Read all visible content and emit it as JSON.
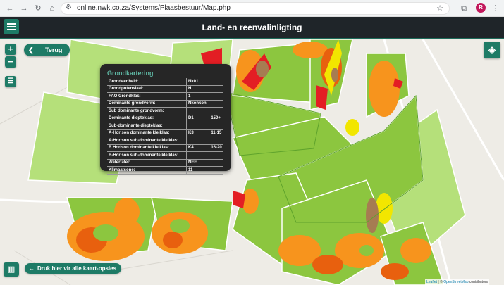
{
  "browser": {
    "url": "online.nwk.co.za/Systems/Plaasbestuur/Map.php",
    "avatar_letter": "R"
  },
  "app": {
    "title": "Land- en reenvalinligting"
  },
  "controls": {
    "zoom_in": "+",
    "zoom_out": "−",
    "back_label": "Terug",
    "options_label": "Druk hier vir alle kaart-opsies"
  },
  "popup": {
    "title": "Grondkartering",
    "rows": [
      {
        "label": "Grondeenheid:",
        "value": "Nk01",
        "extra": ""
      },
      {
        "label": "Grondpotensiaal:",
        "value": "H",
        "extra": ""
      },
      {
        "label": "FAO Grondklas:",
        "value": "1",
        "extra": ""
      },
      {
        "label": "Dominante grondvorm:",
        "value": "Nkonkoni",
        "extra": ""
      },
      {
        "label": "Sub dominante grondvorm:",
        "value": "",
        "extra": ""
      },
      {
        "label": "Dominante diepteklas:",
        "value": "D1",
        "extra": "150+"
      },
      {
        "label": "Sub-dominante diepteklas:",
        "value": "",
        "extra": ""
      },
      {
        "label": "A-Horison dominante kleiklas:",
        "value": "K3",
        "extra": "11-15"
      },
      {
        "label": "A-Horison sub-dominante kleiklas:",
        "value": "",
        "extra": ""
      },
      {
        "label": "B Horison dominante kleiklas:",
        "value": "K4",
        "extra": "16-20"
      },
      {
        "label": "B-Horison sub-dominante kleiklas:",
        "value": "",
        "extra": ""
      },
      {
        "label": "Watertafel:",
        "value": "NEE",
        "extra": ""
      },
      {
        "label": "Klimaatsone:",
        "value": "11",
        "extra": ""
      }
    ]
  },
  "attribution": {
    "leaflet": "Leaflet",
    "separator": "|",
    "copyright": "©",
    "osm": "OpenStreetMap",
    "suffix": "contributors"
  },
  "icons": {
    "back": "arrow-left-icon",
    "layers": "layers-icon",
    "map": "map-icon",
    "filter": "filter-icon",
    "menu": "hamburger-menu-icon"
  },
  "colors": {
    "accent": "#1e7b66",
    "header": "#1f2529",
    "popup_bg": "#262626",
    "popup_title": "#5fb9a5",
    "field_green": "#8cc63f",
    "field_light_green": "#b5e07a",
    "soil_orange": "#f7941d",
    "soil_dark_orange": "#e8600e",
    "soil_red": "#e31e24",
    "soil_yellow": "#f2e600",
    "soil_brown": "#a67c52"
  }
}
